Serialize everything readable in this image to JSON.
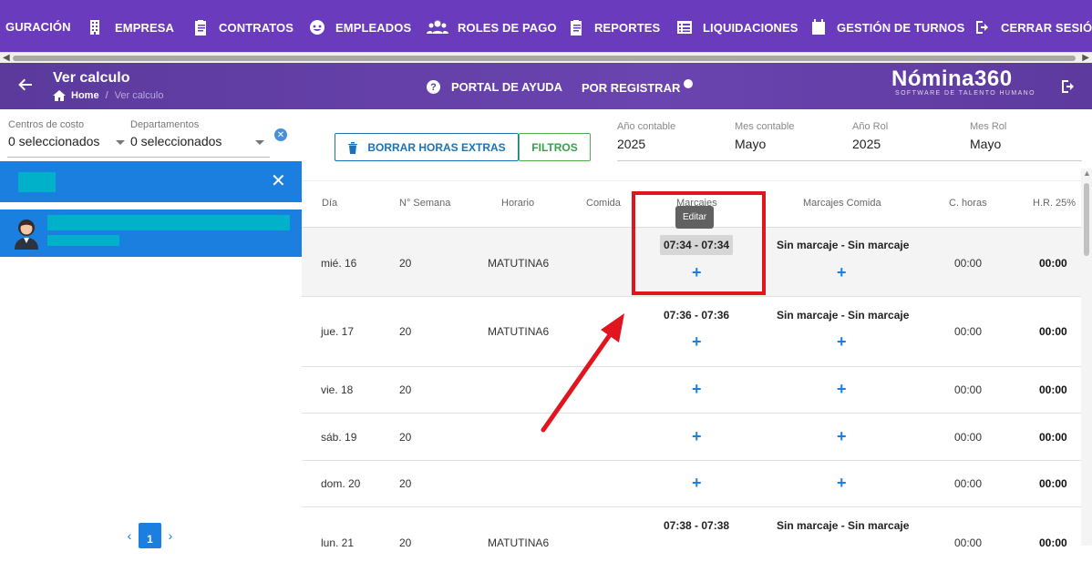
{
  "nav": {
    "items": [
      {
        "label": "GURACIÓN",
        "icon": "none"
      },
      {
        "label": "EMPRESA",
        "icon": "building-icon"
      },
      {
        "label": "CONTRATOS",
        "icon": "clipboard-icon"
      },
      {
        "label": "EMPLEADOS",
        "icon": "employee-face-icon"
      },
      {
        "label": "ROLES DE PAGO",
        "icon": "group-icon"
      },
      {
        "label": "REPORTES",
        "icon": "report-clipboard-icon"
      },
      {
        "label": "LIQUIDACIONES",
        "icon": "list-icon"
      },
      {
        "label": "GESTIÓN DE TURNOS",
        "icon": "calendar-icon"
      },
      {
        "label": "CERRAR SESIÓN",
        "icon": "logout-icon"
      }
    ]
  },
  "header": {
    "title": "Ver calculo",
    "breadcrumb_home": "Home",
    "breadcrumb_sep": "/",
    "breadcrumb_current": "Ver calculo",
    "help_label": "PORTAL DE AYUDA",
    "help_icon": "?",
    "pending_label": "POR REGISTRAR",
    "brand": "Nómina360",
    "brand_tagline": "SOFTWARE DE TALENTO HUMANO"
  },
  "filters": {
    "cost_centers_label": "Centros de costo",
    "cost_centers_value": "0 seleccionados",
    "departments_label": "Departamentos",
    "departments_value": "0 seleccionados",
    "clear_icon": "✕"
  },
  "left": {
    "close_icon": "✕",
    "pagination_prev": "‹",
    "pagination_page": "1",
    "pagination_next": "›"
  },
  "toolbar": {
    "delete_overtime_label": "BORRAR HORAS EXTRAS",
    "filters_label": "FILTROS"
  },
  "period": {
    "year_label": "Año contable",
    "year_value": "2025",
    "month_label": "Mes contable",
    "month_value": "Mayo",
    "role_year_label": "Año Rol",
    "role_year_value": "2025",
    "role_month_label": "Mes Rol",
    "role_month_value": "Mayo"
  },
  "table": {
    "headers": [
      "Día",
      "N° Semana",
      "Horario",
      "Comida",
      "Marcajes",
      "Marcajes Comida",
      "C. horas",
      "H.R. 25%"
    ],
    "tooltip": "Editar",
    "add_icon": "+",
    "rows": [
      {
        "day": "mié. 16",
        "week": "20",
        "schedule": "MATUTINA6",
        "marcajes": "07:34 - 07:34",
        "comida": "Sin marcaje - Sin marcaje",
        "choras": "00:00",
        "hr25": "00:00"
      },
      {
        "day": "jue. 17",
        "week": "20",
        "schedule": "MATUTINA6",
        "marcajes": "07:36 - 07:36",
        "comida": "Sin marcaje - Sin marcaje",
        "choras": "00:00",
        "hr25": "00:00"
      },
      {
        "day": "vie. 18",
        "week": "20",
        "schedule": "",
        "marcajes": "",
        "comida": "",
        "choras": "00:00",
        "hr25": "00:00"
      },
      {
        "day": "sáb. 19",
        "week": "20",
        "schedule": "",
        "marcajes": "",
        "comida": "",
        "choras": "00:00",
        "hr25": "00:00"
      },
      {
        "day": "dom. 20",
        "week": "20",
        "schedule": "",
        "marcajes": "",
        "comida": "",
        "choras": "00:00",
        "hr25": "00:00"
      },
      {
        "day": "lun. 21",
        "week": "20",
        "schedule": "MATUTINA6",
        "marcajes": "07:38 - 07:38",
        "comida": "Sin marcaje - Sin marcaje",
        "choras": "00:00",
        "hr25": "00:00"
      }
    ]
  },
  "colors": {
    "nav_bg": "#6a3bbd",
    "header_bg": "#5d3a9e",
    "accent_blue": "#1b7fe0",
    "highlight_red": "#e0151e",
    "filter_green": "#4caf50"
  }
}
